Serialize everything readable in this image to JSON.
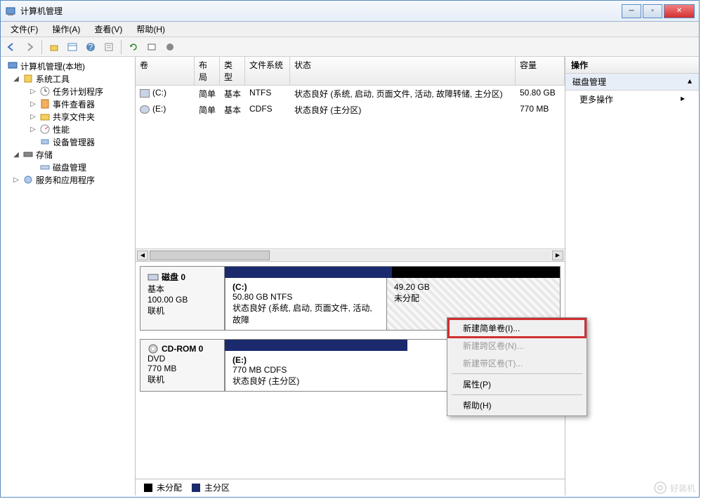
{
  "window": {
    "title": "计算机管理"
  },
  "menu": {
    "file": "文件(F)",
    "action": "操作(A)",
    "view": "查看(V)",
    "help": "帮助(H)"
  },
  "tree": {
    "root": "计算机管理(本地)",
    "systools": "系统工具",
    "scheduler": "任务计划程序",
    "eventviewer": "事件查看器",
    "shared": "共享文件夹",
    "perf": "性能",
    "devmgr": "设备管理器",
    "storage": "存储",
    "diskmgmt": "磁盘管理",
    "services": "服务和应用程序"
  },
  "vol_headers": {
    "vol": "卷",
    "layout": "布局",
    "type": "类型",
    "fs": "文件系统",
    "status": "状态",
    "capacity": "容量"
  },
  "volumes": [
    {
      "name": "(C:)",
      "layout": "简单",
      "type": "基本",
      "fs": "NTFS",
      "status": "状态良好 (系统, 启动, 页面文件, 活动, 故障转储, 主分区)",
      "capacity": "50.80 GB"
    },
    {
      "name": "(E:)",
      "layout": "简单",
      "type": "基本",
      "fs": "CDFS",
      "status": "状态良好 (主分区)",
      "capacity": "770 MB"
    }
  ],
  "disks": {
    "disk0": {
      "title": "磁盘 0",
      "type": "基本",
      "size": "100.00 GB",
      "state": "联机"
    },
    "disk0_c": {
      "name": "(C:)",
      "size": "50.80 GB NTFS",
      "status": "状态良好 (系统, 启动, 页面文件, 活动, 故障"
    },
    "disk0_unalloc": {
      "size": "49.20 GB",
      "label": "未分配"
    },
    "cdrom": {
      "title": "CD-ROM 0",
      "type": "DVD",
      "size": "770 MB",
      "state": "联机"
    },
    "cdrom_e": {
      "name": "(E:)",
      "size": "770 MB CDFS",
      "status": "状态良好 (主分区)"
    }
  },
  "legend": {
    "unalloc": "未分配",
    "primary": "主分区"
  },
  "actions": {
    "header": "操作",
    "diskmgmt": "磁盘管理",
    "more": "更多操作"
  },
  "context": {
    "simple": "新建简单卷(I)...",
    "spanned": "新建跨区卷(N)...",
    "striped": "新建带区卷(T)...",
    "properties": "属性(P)",
    "help": "帮助(H)"
  },
  "watermark": "好装机"
}
